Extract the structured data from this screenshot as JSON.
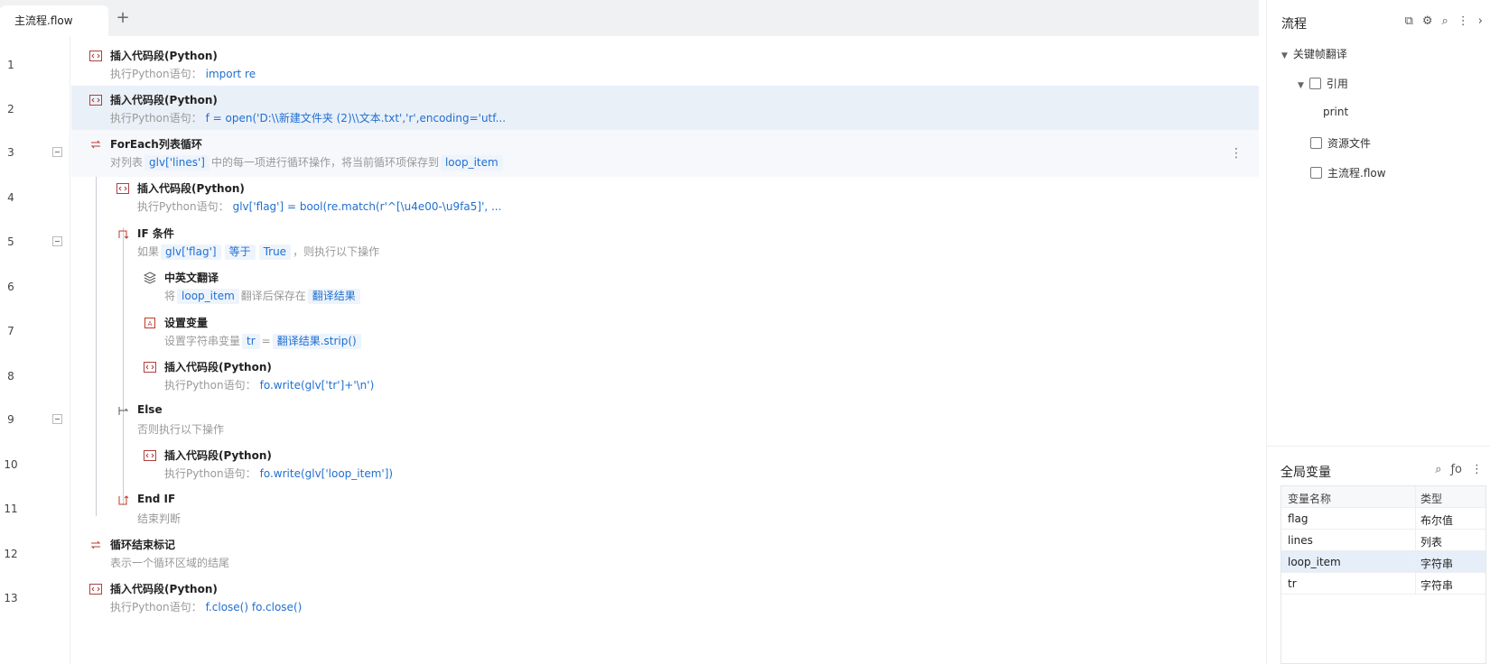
{
  "tab": {
    "label": "主流程.flow",
    "add_glyph": "+"
  },
  "lines": [
    {
      "n": "1",
      "title": "插入代码段(Python)",
      "prefix": "执行Python语句：",
      "code": "import re"
    },
    {
      "n": "2",
      "title": "插入代码段(Python)",
      "prefix": "执行Python语句：",
      "code": "f = open('D:\\\\新建文件夹 (2)\\\\文本.txt','r',encoding='utf..."
    },
    {
      "n": "3",
      "title": "ForEach列表循环",
      "d1": "对列表",
      "c1": "glv['lines']",
      "d2": "中的每一项进行循环操作，将当前循环项保存到",
      "c2": "loop_item"
    },
    {
      "n": "4",
      "title": "插入代码段(Python)",
      "prefix": "执行Python语句：",
      "code": "glv['flag'] =  bool(re.match(r'^[\\u4e00-\\u9fa5]', ..."
    },
    {
      "n": "5",
      "title": "IF 条件",
      "d1": "如果",
      "c1": "glv['flag']",
      "op": "等于",
      "val": "True",
      "d2": "，则执行以下操作"
    },
    {
      "n": "6",
      "title": "中英文翻译",
      "d1": "将",
      "c1": "loop_item",
      "d2": "翻译后保存在",
      "c2": "翻译结果"
    },
    {
      "n": "7",
      "title": "设置变量",
      "d1": "设置字符串变量",
      "c1": "tr",
      "d2": "=",
      "c2": "翻译结果.strip()"
    },
    {
      "n": "8",
      "title": "插入代码段(Python)",
      "prefix": "执行Python语句：",
      "code": "fo.write(glv['tr']+'\\n')"
    },
    {
      "n": "9",
      "title": "Else",
      "d1": "否则执行以下操作"
    },
    {
      "n": "10",
      "title": "插入代码段(Python)",
      "prefix": "执行Python语句：",
      "code": "fo.write(glv['loop_item'])"
    },
    {
      "n": "11",
      "title": "End IF",
      "d1": "结束判断"
    },
    {
      "n": "12",
      "title": "循环结束标记",
      "d1": "表示一个循环区域的结尾"
    },
    {
      "n": "13",
      "title": "插入代码段(Python)",
      "prefix": "执行Python语句：",
      "code": "f.close() fo.close()"
    }
  ],
  "panel": {
    "title": "流程",
    "tree": {
      "root": "关键帧翻译",
      "ref": "引用",
      "ref_child": "print",
      "res": "资源文件",
      "flow": "主流程.flow"
    }
  },
  "globals": {
    "title": "全局变量",
    "fx_glyph": "ƒo",
    "headers": [
      "变量名称",
      "类型"
    ],
    "rows": [
      [
        "flag",
        "布尔值"
      ],
      [
        "lines",
        "列表"
      ],
      [
        "loop_item",
        "字符串"
      ],
      [
        "tr",
        "字符串"
      ]
    ]
  },
  "icons": [
    "code-icon",
    "loop-icon",
    "if-icon",
    "translate-icon",
    "variable-icon",
    "else-icon",
    "endif-icon",
    "search-icon",
    "more-icon",
    "chevron-right-icon",
    "settings-icon",
    "layers-icon"
  ]
}
